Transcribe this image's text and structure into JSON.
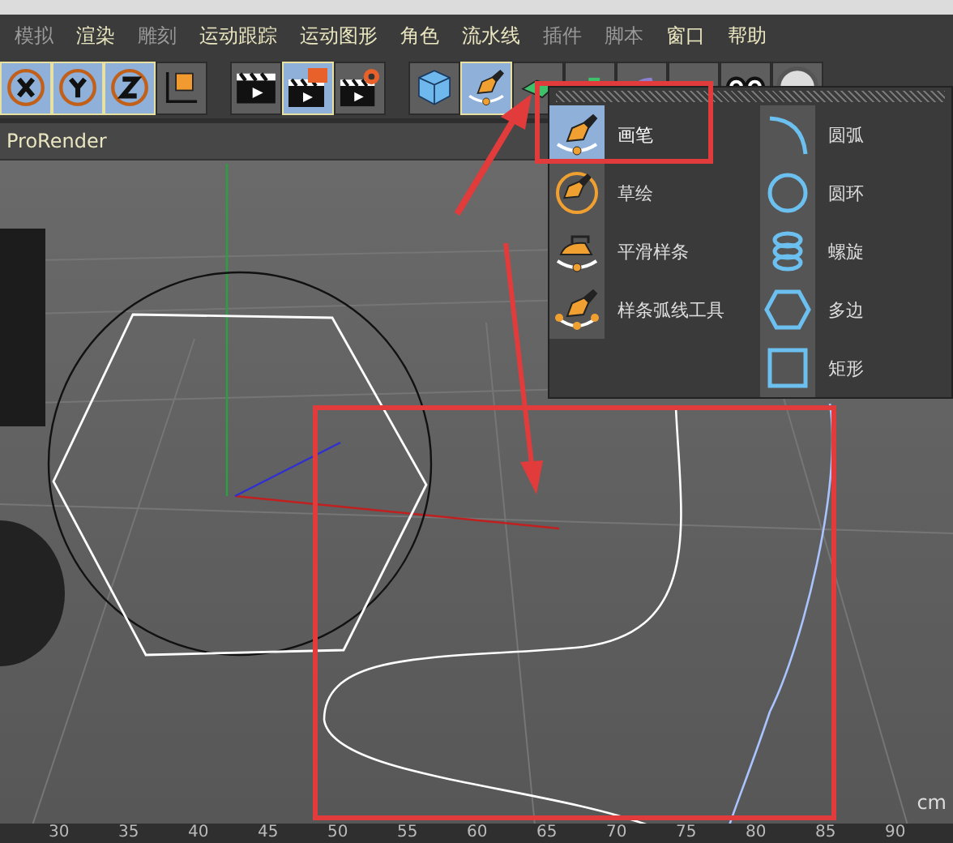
{
  "menu": [
    {
      "label": "模拟",
      "disabled": true
    },
    {
      "label": "渲染",
      "disabled": false
    },
    {
      "label": "雕刻",
      "disabled": true
    },
    {
      "label": "运动跟踪",
      "disabled": false
    },
    {
      "label": "运动图形",
      "disabled": false
    },
    {
      "label": "角色",
      "disabled": false
    },
    {
      "label": "流水线",
      "disabled": false
    },
    {
      "label": "插件",
      "disabled": true
    },
    {
      "label": "脚本",
      "disabled": true
    },
    {
      "label": "窗口",
      "disabled": false
    },
    {
      "label": "帮助",
      "disabled": false
    }
  ],
  "toolbar": [
    {
      "kind": "x",
      "selected": true
    },
    {
      "kind": "y",
      "selected": true
    },
    {
      "kind": "z",
      "selected": true
    },
    {
      "kind": "coords",
      "selected": false,
      "group_end": true
    },
    {
      "kind": "render",
      "selected": false
    },
    {
      "kind": "render-view",
      "selected": true
    },
    {
      "kind": "render-settings",
      "selected": false,
      "group_end": true
    },
    {
      "kind": "cube",
      "selected": false
    },
    {
      "kind": "pen",
      "selected": true
    },
    {
      "kind": "subdiv",
      "selected": false
    },
    {
      "kind": "cloner",
      "selected": false
    },
    {
      "kind": "deformer",
      "selected": false
    },
    {
      "kind": "floor",
      "selected": false
    },
    {
      "kind": "camera",
      "selected": false
    },
    {
      "kind": "light",
      "selected": false
    }
  ],
  "viewport_header": {
    "title": "ProRender"
  },
  "popup": {
    "left_items": [
      {
        "label": "画笔",
        "kind": "pen",
        "selected": true
      },
      {
        "label": "草绘",
        "kind": "sketch",
        "selected": false
      },
      {
        "label": "平滑样条",
        "kind": "smooth",
        "selected": false
      },
      {
        "label": "样条弧线工具",
        "kind": "arc-tool",
        "selected": false
      }
    ],
    "right_items": [
      {
        "label": "圆弧",
        "kind": "arc"
      },
      {
        "label": "圆环",
        "kind": "circle"
      },
      {
        "label": "螺旋",
        "kind": "helix"
      },
      {
        "label": "多边",
        "kind": "polygon"
      },
      {
        "label": "矩形",
        "kind": "rectangle"
      }
    ]
  },
  "viewport": {
    "unit": "cm"
  },
  "ruler": [
    "30",
    "35",
    "40",
    "45",
    "50",
    "55",
    "60",
    "65",
    "70",
    "75",
    "80",
    "85",
    "90"
  ]
}
